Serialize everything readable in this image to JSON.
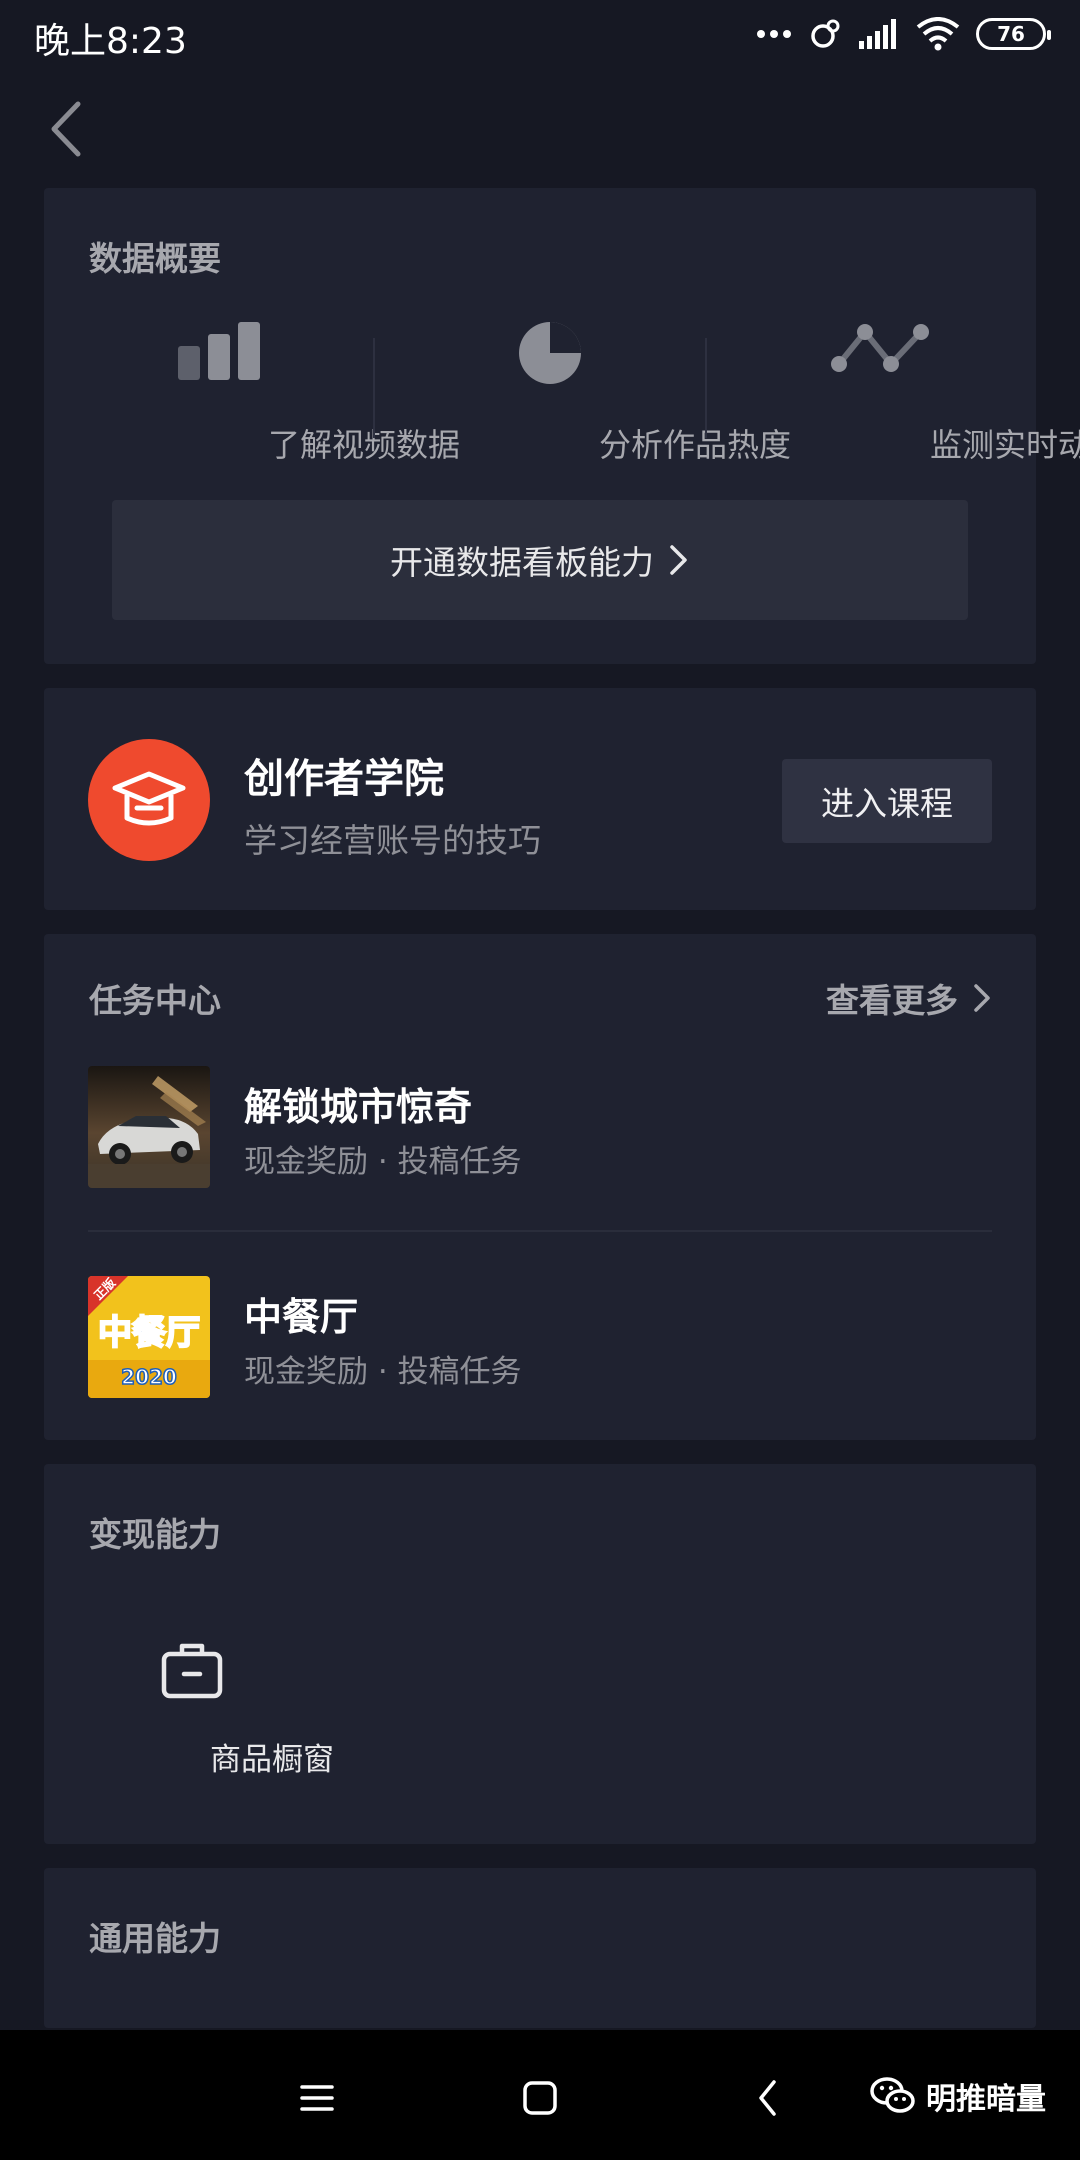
{
  "status_bar": {
    "time": "晚上8:23",
    "battery": "76"
  },
  "data_overview": {
    "title": "数据概要",
    "metrics": [
      {
        "label": "了解视频数据",
        "icon": "bar-chart-icon"
      },
      {
        "label": "分析作品热度",
        "icon": "pie-chart-icon"
      },
      {
        "label": "监测实时动态",
        "icon": "line-trend-icon"
      }
    ],
    "open_button": "开通数据看板能力"
  },
  "academy": {
    "title": "创作者学院",
    "subtitle": "学习经营账号的技巧",
    "button": "进入课程",
    "logo_color": "#ef4a2e"
  },
  "tasks": {
    "title": "任务中心",
    "see_more": "查看更多",
    "items": [
      {
        "title": "解锁城市惊奇",
        "subtitle": "现金奖励 · 投稿任务"
      },
      {
        "title": "中餐厅",
        "subtitle": "现金奖励 · 投稿任务",
        "thumb_badge": "正版",
        "thumb_logo": "中餐厅",
        "thumb_year": "2020"
      }
    ]
  },
  "monetize": {
    "title": "变现能力",
    "items": [
      {
        "label": "商品橱窗",
        "icon": "briefcase-icon"
      }
    ]
  },
  "general": {
    "title": "通用能力"
  },
  "watermark": {
    "text": "明推暗量"
  }
}
